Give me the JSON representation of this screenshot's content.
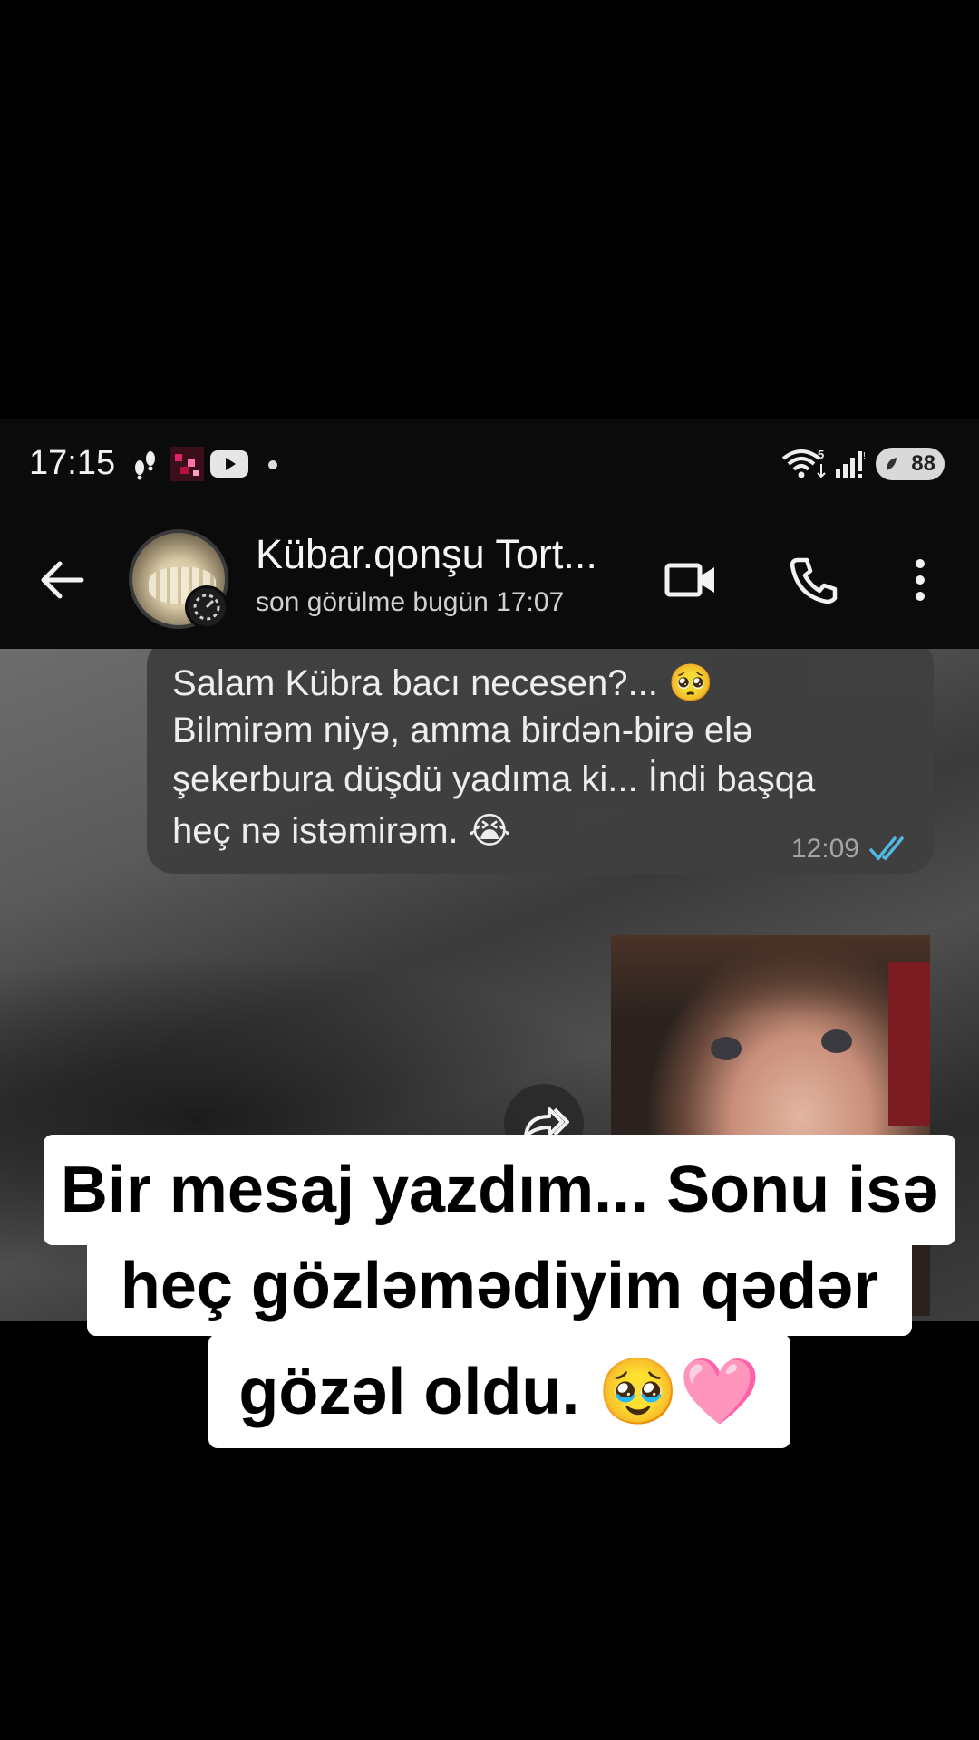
{
  "status_bar": {
    "time": "17:15",
    "battery": "88",
    "icons": [
      "steps-icon",
      "app-thumbnail-icon",
      "youtube-icon",
      "wifi-icon",
      "signal-icon"
    ]
  },
  "app_bar": {
    "contact_name": "Kübar.qonşu Tort...",
    "contact_status": "son görülme bugün 17:07",
    "icons": [
      "back-arrow-icon",
      "video-call-icon",
      "voice-call-icon",
      "more-vert-icon"
    ]
  },
  "chat": {
    "message": {
      "lines": [
        "Salam Kübra bacı necesen?... 🥺",
        "Bilmirəm niyə, amma birdən-birə elə",
        "şekerbura düşdü yadıma ki... İndi başqa",
        "heç nə istəmirəm. 😭"
      ],
      "time": "12:09",
      "status": "read"
    },
    "image_message": {
      "icon": "forward-icon"
    }
  },
  "caption": {
    "line1": "Bir mesaj yazdım... Sonu isə",
    "line2": "heç gözləmədiyim qədər",
    "line3": "gözəl oldu. 🥹🩷"
  },
  "colors": {
    "background": "#000000",
    "bar": "#0b0b0b",
    "bubble": "#3f3f3f",
    "read_ticks": "#53bdeb",
    "caption_bg": "#ffffff"
  }
}
